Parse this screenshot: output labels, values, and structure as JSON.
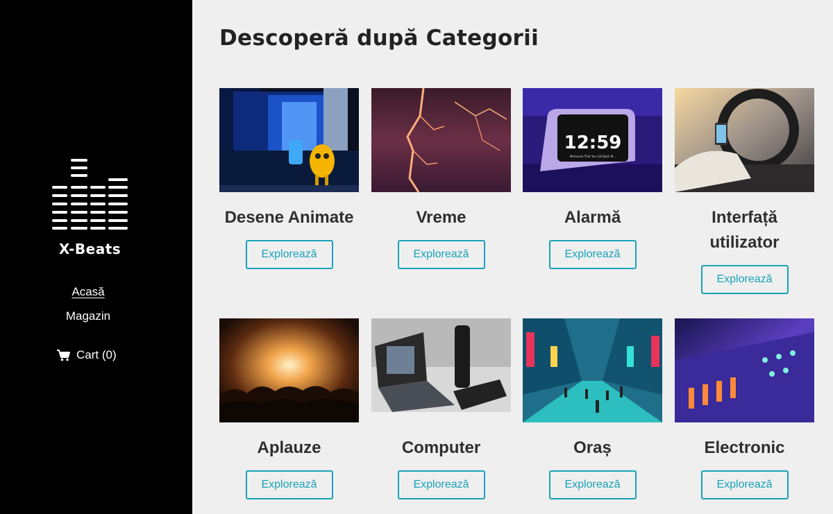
{
  "sidebar": {
    "brand": "X-Beats",
    "logo_icon": "equalizer-bars-icon",
    "nav": [
      {
        "label": "Acasă",
        "active": true
      },
      {
        "label": "Magazin",
        "active": false
      }
    ],
    "cart": {
      "label": "Cart (0)",
      "icon": "shopping-cart-icon"
    }
  },
  "main": {
    "title": "Descoperă după Categorii",
    "button_label": "Explorează",
    "categories": [
      {
        "name": "Desene Animate"
      },
      {
        "name": "Vreme"
      },
      {
        "name": "Alarmă",
        "clock_time": "12:59",
        "clock_caption": "Memories That You Call Back M..."
      },
      {
        "name": "Interfață utilizator"
      },
      {
        "name": "Aplauze"
      },
      {
        "name": "Computer"
      },
      {
        "name": "Oraș"
      },
      {
        "name": "Electronic"
      }
    ]
  },
  "colors": {
    "sidebar_bg": "#000000",
    "page_bg": "#efefef",
    "accent": "#17a2b8",
    "heading": "#222222"
  }
}
